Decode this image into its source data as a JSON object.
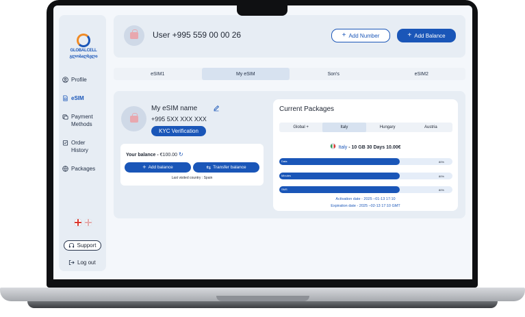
{
  "sidebar": {
    "logo": {
      "line1": "GLOBALCELL",
      "line2": "გლობალსელი"
    },
    "items": [
      {
        "label": "Profile",
        "icon": "user-icon",
        "active": false
      },
      {
        "label": "eSIM",
        "icon": "sim-icon",
        "active": true
      },
      {
        "label": "Payment",
        "label2": "Methods",
        "icon": "payment-icon",
        "active": false
      },
      {
        "label": "Order",
        "label2": "History",
        "icon": "order-history-icon",
        "active": false
      },
      {
        "label": "Packages",
        "icon": "packages-icon",
        "active": false
      }
    ],
    "support_label": "Support",
    "logout_label": "Log out"
  },
  "header": {
    "user_title": "User +995 559 00 00 26",
    "add_number_label": "Add Number",
    "add_balance_label": "Add Balance"
  },
  "tabs": [
    {
      "label": "eSIM1",
      "active": false
    },
    {
      "label": "My eSIM",
      "active": true
    },
    {
      "label": "Son's",
      "active": false
    },
    {
      "label": "eSIM2",
      "active": false
    }
  ],
  "esim": {
    "name": "My eSIM name",
    "number": "+995 5XX XXX XXX",
    "kyc_label": "KYC Verification",
    "balance_label": "Your balance -",
    "balance_value": "€100.00",
    "add_balance_label": "Add balance",
    "transfer_balance_label": "Transfer balance",
    "last_visited": "Last visited country : Spain"
  },
  "packages": {
    "title": "Current Packages",
    "tabs": [
      {
        "label": "Global +",
        "active": false
      },
      {
        "label": "Italy",
        "active": true
      },
      {
        "label": "Hungary",
        "active": false
      },
      {
        "label": "Austria",
        "active": false
      }
    ],
    "country": "Italy",
    "offer": " - 10 GB 30 Days 10.00€",
    "usage": [
      {
        "label": "Data",
        "percent_label": "80%",
        "fraction": 0.8
      },
      {
        "label": "Minutes",
        "percent_label": "80%",
        "fraction": 0.8
      },
      {
        "label": "SMS",
        "percent_label": "80%",
        "fraction": 0.8
      }
    ],
    "activation": "Activation date - 2025 –01-13 17:10",
    "expiration": "Expiration date - 2025 –02-13 17:10 GMT"
  },
  "colors": {
    "accent": "#1a56b8",
    "panel": "#e7edf4",
    "active_tab": "#d7e2f0"
  }
}
